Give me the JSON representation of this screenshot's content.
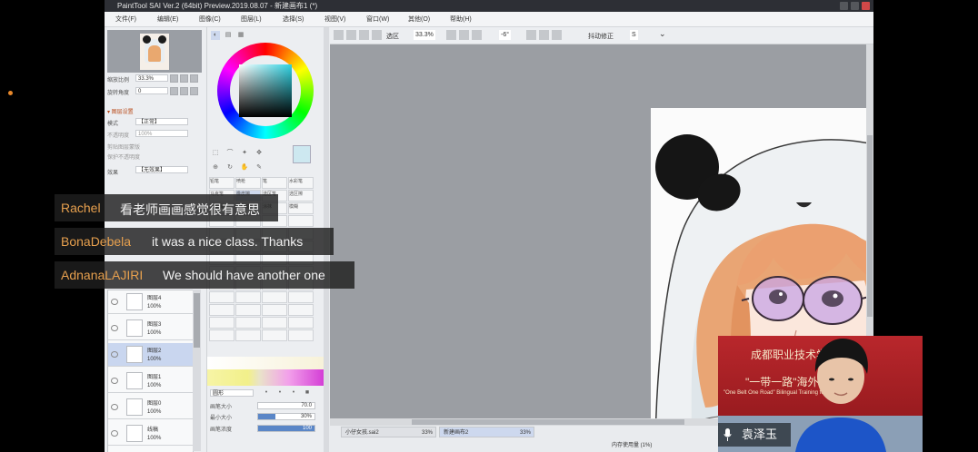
{
  "app": {
    "title": "PaintTool SAI Ver.2 (64bit) Preview.2019.08.07 - 新建画布1 (*)",
    "menu": [
      "文件(F)",
      "编辑(E)",
      "图像(C)",
      "图层(L)",
      "选择(S)",
      "视图(V)",
      "窗口(W)",
      "其他(O)",
      "帮助(H)"
    ]
  },
  "left_panel": {
    "zoom_label": "缩放比例",
    "zoom_value": "33.3%",
    "angle_label": "旋转角度",
    "angle_value": "0",
    "section_title": "▾ 图层设置",
    "mode_label": "模式",
    "mode_value": "【正常】",
    "opacity_label": "不透明度",
    "opacity_value": "100%",
    "clip_label": "剪贴图层蒙版",
    "protect_label": "保护不透明度",
    "effect_label": "效果",
    "effect_value": "【无效果】"
  },
  "layers": [
    {
      "name": "图层4",
      "opacity": "100%",
      "selected": false
    },
    {
      "name": "图层3",
      "opacity": "100%",
      "selected": false
    },
    {
      "name": "图层2",
      "opacity": "100%",
      "selected": true
    },
    {
      "name": "图层1",
      "opacity": "100%",
      "selected": false
    },
    {
      "name": "图层0",
      "opacity": "100%",
      "selected": false
    },
    {
      "name": "线稿",
      "opacity": "100%",
      "selected": false
    }
  ],
  "tool_panel": {
    "brush_shape": "圆形",
    "size_label": "画笔大小",
    "size_value": "70.0",
    "min_size_label": "最小大小",
    "min_size_value": "30%",
    "min_size_frac": 0.3,
    "density_label": "画笔浓度",
    "density_value": "100",
    "density_frac": 1.0,
    "brushes": [
      "铅笔",
      "喷枪",
      "笔",
      "水彩笔",
      "马克笔",
      "橡皮擦",
      "选区笔",
      "选区擦",
      "油漆桶",
      "二值笔",
      "涂抹",
      "模糊"
    ]
  },
  "canvas_toolbar": {
    "selection_label": "选区",
    "zoom": "33.3%",
    "angle": "-6°",
    "stabilizer_label": "抖动修正",
    "stabilizer_value": "S"
  },
  "statusbar": {
    "tabs": [
      {
        "label": "小仔女孩.sai2",
        "zoom": "33%",
        "active": false
      },
      {
        "label": "新建画布2",
        "zoom": "33%",
        "active": true
      }
    ],
    "status_text": "内存使用量 (1%)"
  },
  "chat": [
    {
      "name": "Rachel",
      "message": "看老师画画感觉很有意思"
    },
    {
      "name": "BonaDebela",
      "message": "it was a nice class. Thanks"
    },
    {
      "name": "AdnanaLAJIRI",
      "message": "We should have another one"
    }
  ],
  "webcam": {
    "banner_line1": "成都职业技术学院",
    "banner_line2": "\"一带一路\"海外培训",
    "banner_line3": "\"One Belt One Road\" Bilingual Training for Foreign",
    "speaker_name": "袁泽玉"
  },
  "colors": {
    "chat_name": "#e7a04e",
    "webcam_banner": "#b21f24",
    "selected_layer": "#c9d6ef"
  }
}
